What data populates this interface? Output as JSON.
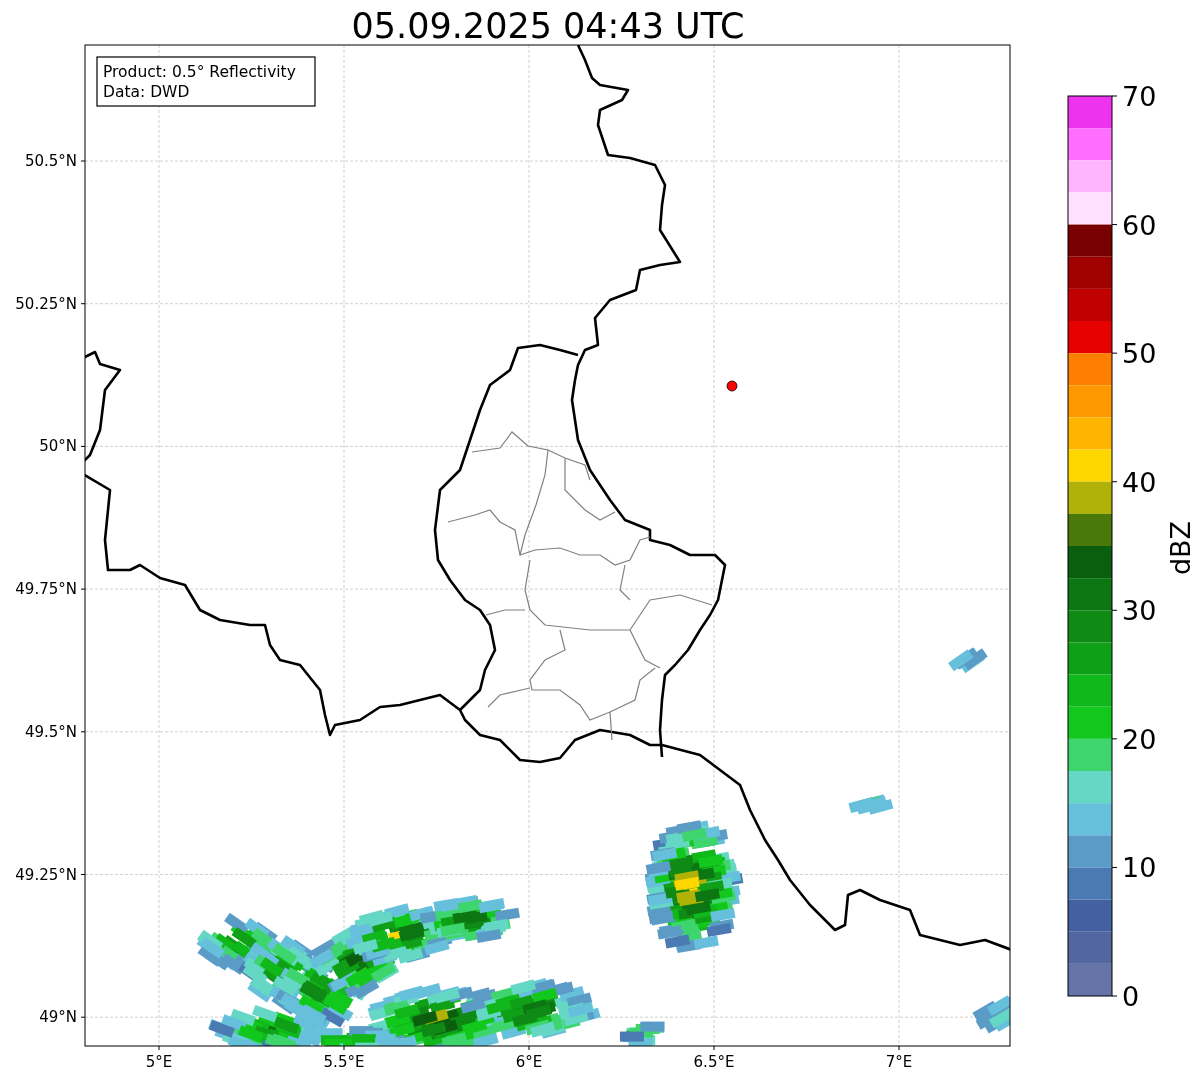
{
  "title": "05.09.2025 04:43 UTC",
  "map": {
    "info_box": [
      "Product: 0.5° Reflectivity",
      "Data: DWD"
    ],
    "lat_labels": [
      "50.5°N",
      "50.25°N",
      "50°N",
      "49.75°N",
      "49.5°N",
      "49.25°N",
      "49°N"
    ],
    "lon_labels": [
      "5°E",
      "5.5°E",
      "6°E",
      "6.5°E",
      "7°E"
    ]
  },
  "colorbar": {
    "label": "dBZ",
    "ticks": [
      "70",
      "60",
      "50",
      "40",
      "30",
      "20",
      "10",
      "0"
    ],
    "bins": [
      {
        "color": "#ee33ee"
      },
      {
        "color": "#ff6eff"
      },
      {
        "color": "#ffb4ff"
      },
      {
        "color": "#ffe0ff"
      },
      {
        "color": "#780000"
      },
      {
        "color": "#a00000"
      },
      {
        "color": "#c00000"
      },
      {
        "color": "#e60000"
      },
      {
        "color": "#ff7f00"
      },
      {
        "color": "#ff9800"
      },
      {
        "color": "#ffb400"
      },
      {
        "color": "#ffd700"
      },
      {
        "color": "#b0b208"
      },
      {
        "color": "#4a780a"
      },
      {
        "color": "#0a5e0e"
      },
      {
        "color": "#0b7612"
      },
      {
        "color": "#0f8a14"
      },
      {
        "color": "#10a018"
      },
      {
        "color": "#10b81c"
      },
      {
        "color": "#12c81c"
      },
      {
        "color": "#3ed46e"
      },
      {
        "color": "#64d8c4"
      },
      {
        "color": "#66c0db"
      },
      {
        "color": "#5b9cc7"
      },
      {
        "color": "#4b7ab3"
      },
      {
        "color": "#4360a0"
      },
      {
        "color": "#52679f"
      },
      {
        "color": "#6574a6"
      }
    ]
  }
}
